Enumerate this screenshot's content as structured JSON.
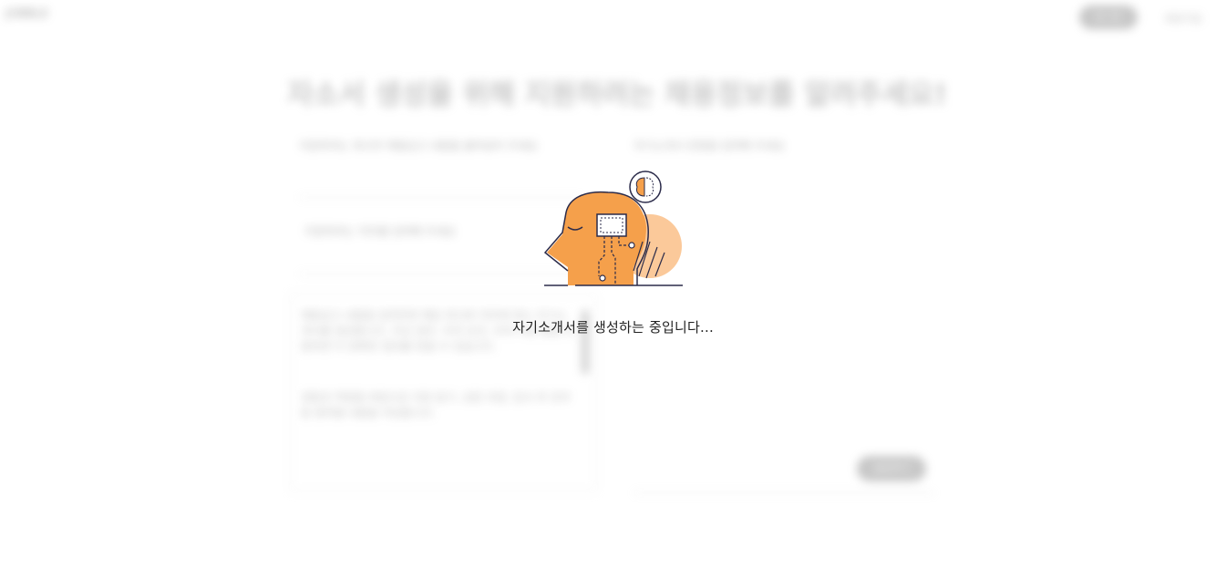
{
  "header": {
    "logo_text": "JOBBLE",
    "nav_button_label": "로그인",
    "nav_link_label": "회원가입"
  },
  "background": {
    "title": "자소서 생성을 위해 지원하려는 채용정보를 알려주세요!",
    "left_field_text": "지원하려는 회사의 채용공고 내용을 붙여넣어 주세요",
    "left_field2_text": "지원하려는 직무를 입력해 주세요",
    "left_paragraph_1": "채용공고 내용을 입력하면 해당 회사와 직무에 맞는 자기소개서를 생성합니다. 주요 업무, 자격 요건, 우대 사항 등을 포함하면 더 정확한 결과를 얻을 수 있습니다.",
    "left_paragraph_2": "경험과 역량을 바탕으로 지원 동기, 성장 과정, 입사 후 포부 등 항목별 내용을 작성합니다.",
    "right_field_text": "자기소개서 문항을 입력해 주세요",
    "submit_label": "생성하기"
  },
  "loading": {
    "message": "자기소개서를 생성하는 중입니다...",
    "illustration_icon": "ai-head-circuit-icon",
    "colors": {
      "accent": "#f5a04b",
      "accent_light": "#fbc99a",
      "outline": "#2b2b4a"
    }
  }
}
